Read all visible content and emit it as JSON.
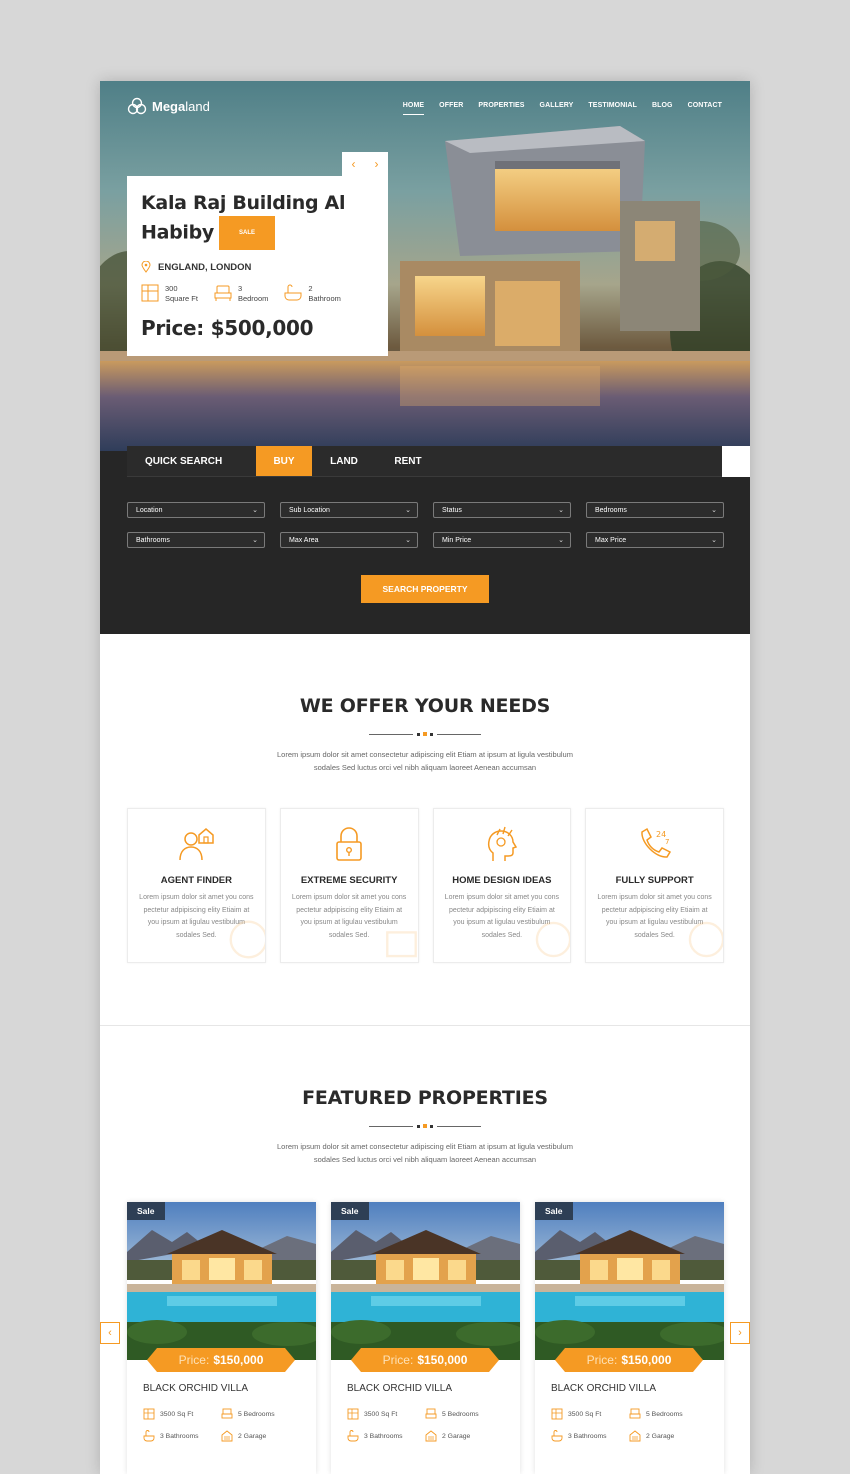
{
  "brand": {
    "name_bold": "Mega",
    "name_rest": "land"
  },
  "nav": [
    "HOME",
    "OFFER",
    "PROPERTIES",
    "GALLERY",
    "TESTIMONIAL",
    "BLOG",
    "CONTACT"
  ],
  "hero": {
    "title": "Kala Raj Building Al Habiby",
    "badge": "SALE",
    "location": "ENGLAND, LONDON",
    "specs": [
      {
        "value": "300",
        "unit": "Square Ft",
        "icon": "area-icon"
      },
      {
        "value": "3",
        "unit": "Bedroom",
        "icon": "bed-icon"
      },
      {
        "value": "2",
        "unit": "Bathroom",
        "icon": "bath-icon"
      }
    ],
    "price": "Price: $500,000"
  },
  "search": {
    "tabs": [
      "QUICK SEARCH",
      "BUY",
      "LAND",
      "RENT"
    ],
    "selects": [
      "Location",
      "Sub Location",
      "Status",
      "Bedrooms",
      "Bathrooms",
      "Max Area",
      "Min Price",
      "Max Price"
    ],
    "button": "SEARCH PROPERTY"
  },
  "offer": {
    "title": "WE OFFER YOUR NEEDS",
    "desc_line1": "Lorem ipsum dolor sit amet consectetur adipiscing elit Etiam at ipsum at ligula vestibulum",
    "desc_line2": "sodales Sed luctus orci vel nibh aliquam laoreet Aenean accumsan",
    "items": [
      {
        "title": "AGENT FINDER",
        "desc": "Lorem ipsum dolor sit amet you cons pectetur adpipiscing elity Etiaim at you ipsum at ligulau vestibulum sodales Sed.",
        "icon": "agent-icon"
      },
      {
        "title": "EXTREME SECURITY",
        "desc": "Lorem ipsum dolor sit amet you cons pectetur adpipiscing elity Etiaim at you ipsum at ligulau vestibulum sodales Sed.",
        "icon": "lock-icon"
      },
      {
        "title": "HOME DESIGN IDEAS",
        "desc": "Lorem ipsum dolor sit amet you cons pectetur adpipiscing elity Etiaim at you ipsum at ligulau vestibulum sodales Sed.",
        "icon": "idea-head-icon"
      },
      {
        "title": "FULLY SUPPORT",
        "desc": "Lorem ipsum dolor sit amet you cons pectetur adpipiscing elity Etiaim at you ipsum at ligulau vestibulum sodales Sed.",
        "icon": "support-24-7-icon"
      }
    ]
  },
  "featured": {
    "title": "FEATURED PROPERTIES",
    "desc_line1": "Lorem ipsum dolor sit amet consectetur adipiscing elit Etiam at ipsum at ligula vestibulum",
    "desc_line2": "sodales Sed luctus orci vel nibh aliquam laoreet Aenean accumsan",
    "cards": [
      {
        "badge": "Sale",
        "price_label": "Price:",
        "price": "$150,000",
        "name": "BLACK ORCHID VILLA",
        "area": "3500 Sq Ft",
        "bedrooms": "5 Bedrooms",
        "bathrooms": "3 Bathrooms",
        "garage": "2 Garage"
      },
      {
        "badge": "Sale",
        "price_label": "Price:",
        "price": "$150,000",
        "name": "BLACK ORCHID VILLA",
        "area": "3500 Sq Ft",
        "bedrooms": "5 Bedrooms",
        "bathrooms": "3 Bathrooms",
        "garage": "2 Garage"
      },
      {
        "badge": "Sale",
        "price_label": "Price:",
        "price": "$150,000",
        "name": "BLACK ORCHID VILLA",
        "area": "3500 Sq Ft",
        "bedrooms": "5 Bedrooms",
        "bathrooms": "3 Bathrooms",
        "garage": "2 Garage"
      }
    ]
  },
  "colors": {
    "accent": "#f59a23",
    "dark": "#262626",
    "badge": "#2e3f55"
  }
}
